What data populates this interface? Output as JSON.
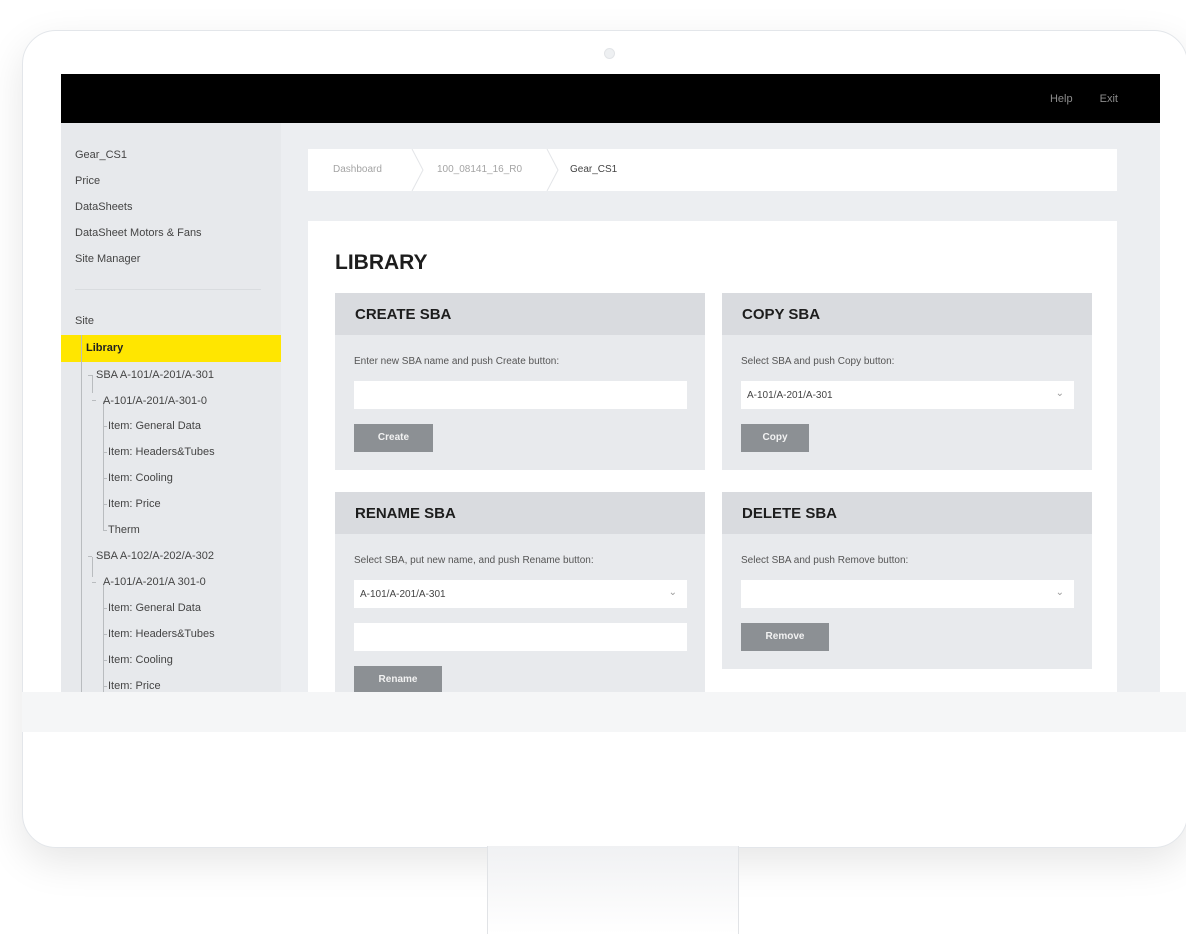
{
  "topbar": {
    "help_label": "Help",
    "exit_label": "Exit"
  },
  "sidebar": {
    "menu": [
      "Gear_CS1",
      "Price",
      "DataSheets",
      "DataSheet Motors & Fans",
      "Site Manager"
    ],
    "site_label": "Site",
    "library_label": "Library",
    "tree": [
      "SBA A-101/A-201/A-301",
      "A-101/A-201/A-301-0",
      "Item: General Data",
      "Item: Headers&Tubes",
      "Item: Cooling",
      "Item: Price",
      "Therm",
      "SBA A-102/A-202/A-302",
      "A-101/A-201/A 301-0",
      "Item: General Data",
      "Item: Headers&Tubes",
      "Item: Cooling",
      "Item: Price"
    ]
  },
  "breadcrumb": [
    "Dashboard",
    "100_08141_16_R0",
    "Gear_CS1"
  ],
  "page_title": "LIBRARY",
  "create": {
    "title": "CREATE SBA",
    "instruction": "Enter new SBA name and push Create button:",
    "input_value": "",
    "button": "Create"
  },
  "copy": {
    "title": "COPY SBA",
    "instruction": "Select SBA and push Copy button:",
    "selected": "A-101/A-201/A-301",
    "button": "Copy"
  },
  "rename": {
    "title": "RENAME SBA",
    "instruction": "Select SBA, put new name, and push Rename button:",
    "selected": "A-101/A-201/A-301",
    "input_value": "",
    "button": "Rename"
  },
  "delete": {
    "title": "DELETE SBA",
    "instruction": "Select SBA and push Remove button:",
    "selected": "",
    "button": "Remove"
  },
  "colors": {
    "highlight": "#ffe600",
    "topbar": "#000000",
    "button": "#8c9094"
  }
}
